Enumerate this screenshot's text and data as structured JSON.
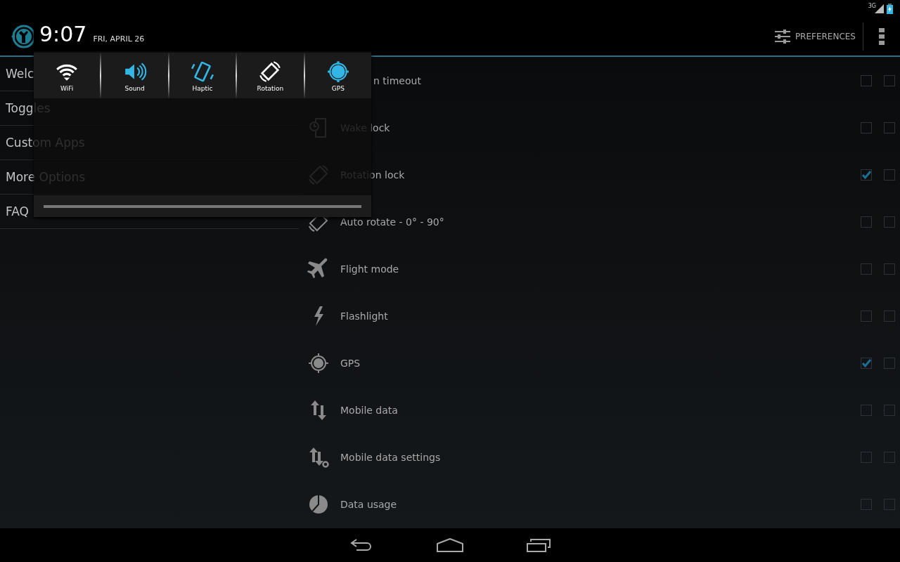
{
  "status_bar": {
    "network": "3G"
  },
  "action_bar": {
    "preferences": "PREFERENCES"
  },
  "sidebar": {
    "items": [
      {
        "label": "Welc"
      },
      {
        "label": "Toggles"
      },
      {
        "label": "Custom Apps"
      },
      {
        "label": "More Options"
      },
      {
        "label": "FAQ"
      }
    ]
  },
  "toggles": [
    {
      "label": "n timeout",
      "kind": "covered",
      "checks": [
        {
          "checked": false
        },
        {
          "checked": false
        }
      ]
    },
    {
      "label": "Wake lock",
      "kind": "normal",
      "checks": [
        {
          "checked": false
        },
        {
          "checked": false
        }
      ]
    },
    {
      "label": "Rotation lock",
      "kind": "normal",
      "checks": [
        {
          "checked": true
        },
        {
          "checked": false
        }
      ]
    },
    {
      "label": "Auto rotate - 0° - 90°",
      "kind": "normal",
      "checks": [
        {
          "checked": false
        },
        {
          "checked": false
        }
      ]
    },
    {
      "label": "Flight mode",
      "kind": "normal",
      "checks": [
        {
          "checked": false
        },
        {
          "checked": false
        }
      ]
    },
    {
      "label": "Flashlight",
      "kind": "normal",
      "checks": [
        {
          "checked": false
        },
        {
          "checked": false
        }
      ]
    },
    {
      "label": "GPS",
      "kind": "normal",
      "checks": [
        {
          "checked": true
        },
        {
          "checked": false
        }
      ]
    },
    {
      "label": "Mobile data",
      "kind": "normal",
      "checks": [
        {
          "checked": false
        },
        {
          "checked": false
        }
      ]
    },
    {
      "label": "Mobile data settings",
      "kind": "normal",
      "checks": [
        {
          "checked": false
        },
        {
          "checked": false
        }
      ]
    },
    {
      "label": "Data usage",
      "kind": "normal",
      "checks": [
        {
          "checked": false
        },
        {
          "checked": false
        }
      ]
    }
  ],
  "notification_panel": {
    "time": "9:07",
    "date": "FRI, APRIL 26",
    "tiles": [
      {
        "label": "WiFi",
        "on": false
      },
      {
        "label": "Sound",
        "on": true
      },
      {
        "label": "Haptic",
        "on": true
      },
      {
        "label": "Rotation",
        "on": false
      },
      {
        "label": "GPS",
        "on": true
      }
    ]
  }
}
